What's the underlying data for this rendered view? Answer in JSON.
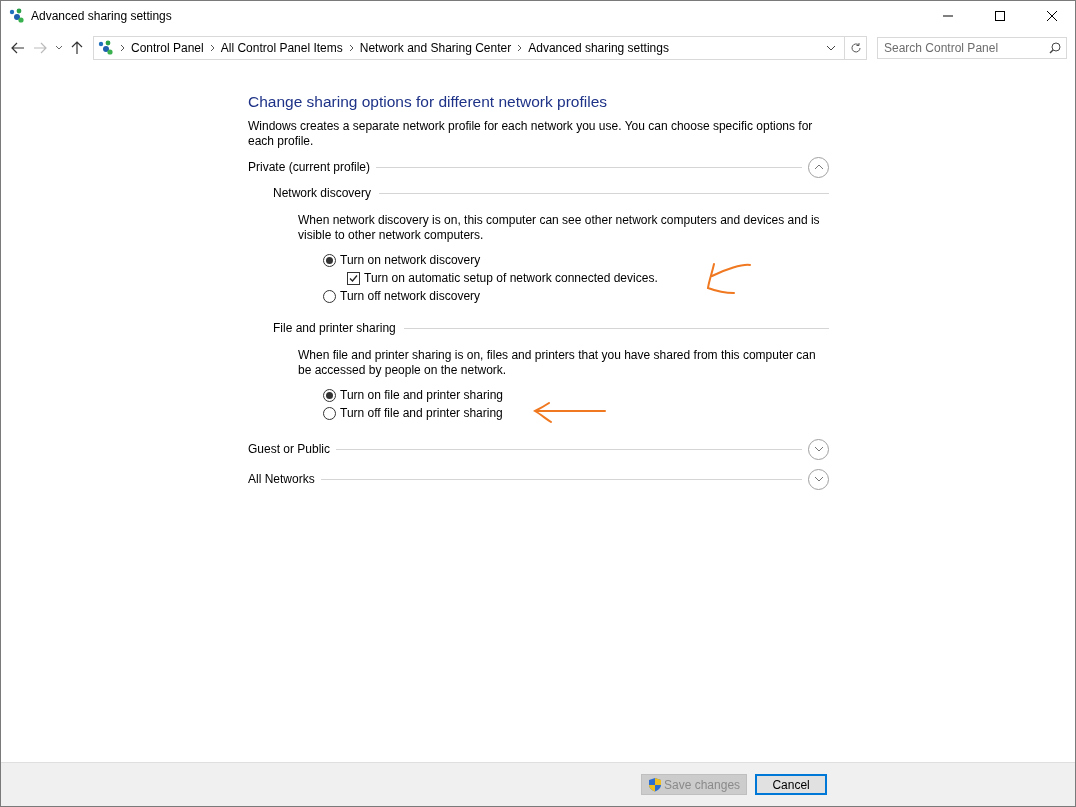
{
  "window": {
    "title": "Advanced sharing settings"
  },
  "address_bar": {
    "breadcrumbs": [
      "Control Panel",
      "All Control Panel Items",
      "Network and Sharing Center",
      "Advanced sharing settings"
    ]
  },
  "search": {
    "placeholder": "Search Control Panel"
  },
  "heading": "Change sharing options for different network profiles",
  "intro": "Windows creates a separate network profile for each network you use. You can choose specific options for each profile.",
  "sections": [
    {
      "title": "Private (current profile)",
      "expanded": true,
      "groups": [
        {
          "title": "Network discovery",
          "description": "When network discovery is on, this computer can see other network computers and devices and is visible to other network computers.",
          "annotated": true,
          "options": [
            {
              "kind": "radio",
              "label": "Turn on network discovery",
              "selected": true,
              "children": [
                {
                  "kind": "checkbox",
                  "label": "Turn on automatic setup of network connected devices.",
                  "checked": true
                }
              ]
            },
            {
              "kind": "radio",
              "label": "Turn off network discovery",
              "selected": false
            }
          ]
        },
        {
          "title": "File and printer sharing",
          "description": "When file and printer sharing is on, files and printers that you have shared from this computer can be accessed by people on the network.",
          "annotated": true,
          "options": [
            {
              "kind": "radio",
              "label": "Turn on file and printer sharing",
              "selected": true
            },
            {
              "kind": "radio",
              "label": "Turn off file and printer sharing",
              "selected": false
            }
          ]
        }
      ]
    },
    {
      "title": "Guest or Public",
      "expanded": false
    },
    {
      "title": "All Networks",
      "expanded": false
    }
  ],
  "buttons": [
    {
      "label": "Save changes",
      "disabled": true,
      "shield": true,
      "default": false
    },
    {
      "label": "Cancel",
      "disabled": false,
      "shield": false,
      "default": true
    }
  ]
}
